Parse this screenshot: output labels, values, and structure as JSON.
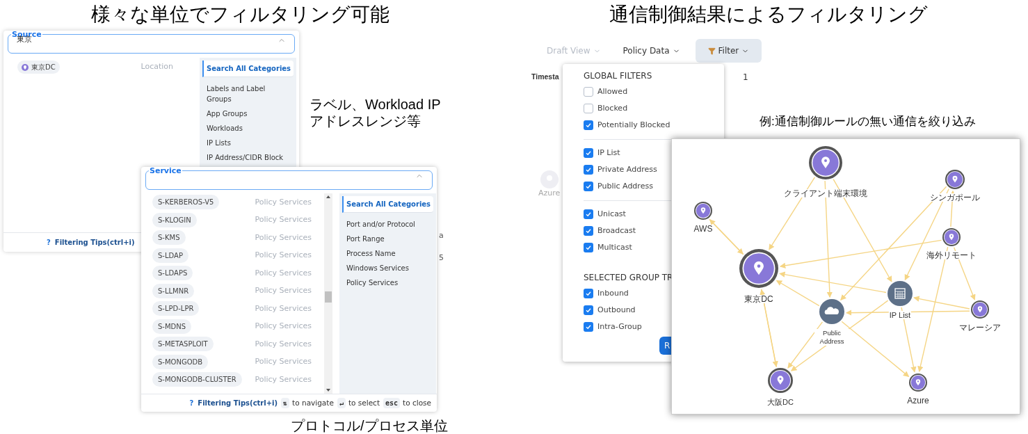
{
  "left_title": "様々な単位でフィルタリング可能",
  "right_title": "通信制御結果によるフィルタリング",
  "source_panel": {
    "label": "Source",
    "value": "東京",
    "results": [
      {
        "name": "東京DC",
        "category": "Location"
      }
    ],
    "categories": [
      {
        "label": "Search All Categories",
        "selected": true
      },
      {
        "label": "Labels and Label Groups",
        "selected": false
      },
      {
        "label": "App Groups",
        "selected": false
      },
      {
        "label": "Workloads",
        "selected": false
      },
      {
        "label": "IP Lists",
        "selected": false
      },
      {
        "label": "IP Address/CIDR Block",
        "selected": false
      }
    ],
    "help_glyph": "?",
    "tip": "Filtering Tips(ctrl+i)"
  },
  "behind_text": [
    "a",
    "5"
  ],
  "label_caption": "ラベル、Workload IPアドレスレンジ等",
  "service_panel": {
    "label": "Service",
    "results": [
      {
        "name": "S-KERBEROS-V5",
        "category": "Policy Services"
      },
      {
        "name": "S-KLOGIN",
        "category": "Policy Services"
      },
      {
        "name": "S-KMS",
        "category": "Policy Services"
      },
      {
        "name": "S-LDAP",
        "category": "Policy Services"
      },
      {
        "name": "S-LDAPS",
        "category": "Policy Services"
      },
      {
        "name": "S-LLMNR",
        "category": "Policy Services"
      },
      {
        "name": "S-LPD-LPR",
        "category": "Policy Services"
      },
      {
        "name": "S-MDNS",
        "category": "Policy Services"
      },
      {
        "name": "S-METASPLOIT",
        "category": "Policy Services"
      },
      {
        "name": "S-MONGODB",
        "category": "Policy Services"
      },
      {
        "name": "S-MONGODB-CLUSTER",
        "category": "Policy Services"
      }
    ],
    "categories": [
      {
        "label": "Search All Categories",
        "selected": true
      },
      {
        "label": "Port and/or Protocol",
        "selected": false
      },
      {
        "label": "Port Range",
        "selected": false
      },
      {
        "label": "Process Name",
        "selected": false
      },
      {
        "label": "Windows Services",
        "selected": false
      },
      {
        "label": "Policy Services",
        "selected": false
      }
    ],
    "help_glyph": "?",
    "tip": "Filtering Tips(ctrl+i)",
    "hints": [
      {
        "key": "⇅",
        "text": "to navigate"
      },
      {
        "key": "↵",
        "text": "to select"
      },
      {
        "key": "esc",
        "text": "to close"
      }
    ]
  },
  "service_caption": "プロトコル/プロセス単位",
  "toolbar": [
    {
      "label": "Draft View",
      "disabled": true,
      "selected": false
    },
    {
      "label": "Policy Data",
      "disabled": false,
      "selected": false
    },
    {
      "label": "Filter",
      "disabled": false,
      "selected": true
    }
  ],
  "timestamp_label": "Timesta",
  "timestamp_tail": "1",
  "faded_node_label": "Azure",
  "filter_panel": {
    "sections": [
      {
        "heading": "GLOBAL FILTERS",
        "items": [
          {
            "label": "Allowed",
            "checked": false
          },
          {
            "label": "Blocked",
            "checked": false
          },
          {
            "label": "Potentially Blocked",
            "checked": true
          }
        ]
      },
      {
        "items": [
          {
            "label": "IP List",
            "checked": true
          },
          {
            "label": "Private Address",
            "checked": true
          },
          {
            "label": "Public Address",
            "checked": true
          }
        ]
      },
      {
        "items": [
          {
            "label": "Unicast",
            "checked": true
          },
          {
            "label": "Broadcast",
            "checked": true
          },
          {
            "label": "Multicast",
            "checked": true
          }
        ]
      },
      {
        "heading": "SELECTED GROUP TR",
        "items": [
          {
            "label": "Inbound",
            "checked": true
          },
          {
            "label": "Outbound",
            "checked": true
          },
          {
            "label": "Intra-Group",
            "checked": true
          }
        ]
      }
    ],
    "apply_button": "R"
  },
  "graph_caption": "例:通信制御ルールの無い通信を絞り込み",
  "graph": {
    "nodes": [
      {
        "label": "クライアント端末環境",
        "kind": "location"
      },
      {
        "label": "AWS",
        "kind": "location"
      },
      {
        "label": "東京DC",
        "kind": "location"
      },
      {
        "label": "シンガポール",
        "kind": "location"
      },
      {
        "label": "海外リモート",
        "kind": "location"
      },
      {
        "label": "IP List",
        "kind": "ip_list"
      },
      {
        "label": "Public Address",
        "kind": "public_address"
      },
      {
        "label": "マレーシア",
        "kind": "location"
      },
      {
        "label": "大阪DC",
        "kind": "location"
      },
      {
        "label": "Azure",
        "kind": "location"
      }
    ]
  }
}
